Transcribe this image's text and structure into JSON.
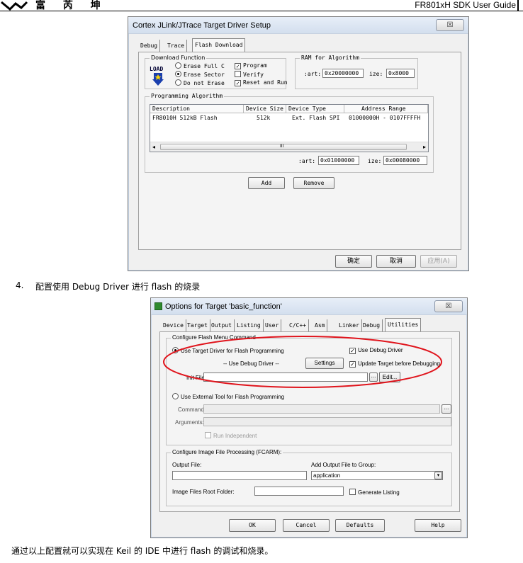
{
  "header": {
    "brand": "富 芮 坤",
    "doc_title": "FR801xH SDK User Guide"
  },
  "dialog1": {
    "title": "Cortex JLink/JTrace Target Driver Setup",
    "close": "☒",
    "tabs": [
      "Debug",
      "Trace",
      "Flash Download"
    ],
    "download_function": {
      "label": "Download Function",
      "logo": "LOAD",
      "options": [
        "Erase Full C",
        "Erase Sector",
        "Do not Erase"
      ],
      "selected_index": 1,
      "checks": [
        {
          "label": "Program",
          "checked": true
        },
        {
          "label": "Verify",
          "checked": false
        },
        {
          "label": "Reset and Run",
          "checked": true
        }
      ]
    },
    "ram": {
      "label": "RAM for Algorithm",
      "start_label": ":art:",
      "start_value": "0x20000000",
      "size_label": "ize:",
      "size_value": "0x8000"
    },
    "prog_algo": {
      "label": "Programming Algorithm",
      "columns": [
        "Description",
        "Device Size",
        "Device Type",
        "Address Range"
      ],
      "rows": [
        [
          "FR8010H 512kB Flash",
          "512k",
          "Ext. Flash SPI",
          "01000000H - 0107FFFFH"
        ]
      ],
      "start_label": ":art:",
      "start_value": "0x01000000",
      "size_label": "ize:",
      "size_value": "0x00080000",
      "scroll_mark": "III"
    },
    "buttons": {
      "add": "Add",
      "remove": "Remove"
    },
    "footer": {
      "ok": "确定",
      "cancel": "取消",
      "apply": "应用(A)"
    }
  },
  "step": {
    "number": "4.",
    "text": "配置使用 Debug Driver 进行 flash 的烧录"
  },
  "dialog2": {
    "title": "Options for Target 'basic_function'",
    "close": "☒",
    "tabs": [
      "Device",
      "Target",
      "Output",
      "Listing",
      "User",
      "C/C++",
      "Asm",
      "Linker",
      "Debug",
      "Utilities"
    ],
    "flash_menu": {
      "label": "Configure Flash Menu Command",
      "use_target": "Use Target Driver for Flash Programming",
      "use_debug_driver": "Use Debug Driver",
      "driver_combo": "-- Use Debug Driver --",
      "settings": "Settings",
      "update_target": "Update Target before Debugging",
      "init_file_label": "Init File:",
      "browse": "...",
      "edit": "Edit...",
      "use_external": "Use External Tool for Flash Programming",
      "command_label": "Command:",
      "arguments_label": "Arguments:",
      "run_independent": "Run Independent"
    },
    "image": {
      "label": "Configure Image File Processing (FCARM):",
      "output_file_label": "Output File:",
      "add_output_label": "Add Output File  to Group:",
      "group_value": "application",
      "root_label": "Image Files Root Folder:",
      "generate_listing": "Generate Listing"
    },
    "footer": {
      "ok": "OK",
      "cancel": "Cancel",
      "defaults": "Defaults",
      "help": "Help"
    },
    "highlight_color": "#e0141c"
  },
  "conclusion": "通过以上配置就可以实现在 Keil 的 IDE 中进行 flash 的调试和烧录。"
}
